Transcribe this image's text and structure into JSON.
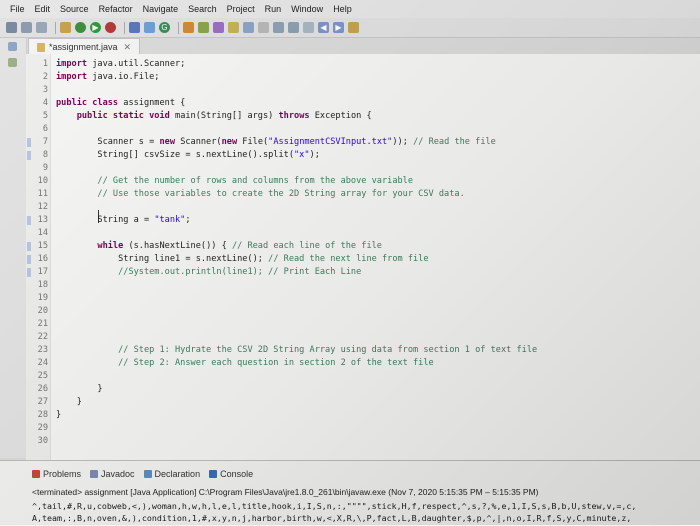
{
  "menu": [
    "File",
    "Edit",
    "Source",
    "Refactor",
    "Navigate",
    "Search",
    "Project",
    "Run",
    "Window",
    "Help"
  ],
  "editor_tab": {
    "label": "*assignment.java",
    "close": "✕"
  },
  "code_lines": [
    {
      "n": "1",
      "html": "<span class=\"kw\">import</span> java.util.Scanner;"
    },
    {
      "n": "2",
      "html": "<span class=\"kw\">import</span> java.io.File;"
    },
    {
      "n": "3",
      "html": ""
    },
    {
      "n": "4",
      "html": "<span class=\"kw\">public class</span> assignment {"
    },
    {
      "n": "5",
      "html": "    <span class=\"kw\">public static void</span> main(String[] args) <span class=\"kw\">throws</span> Exception {"
    },
    {
      "n": "6",
      "html": ""
    },
    {
      "n": "7",
      "html": "        Scanner s = <span class=\"kw\">new</span> Scanner(<span class=\"kw\">new</span> File(<span class=\"str\">\"AssignmentCSVInput.txt\"</span>)); <span class=\"cmt\">// Read the file</span>"
    },
    {
      "n": "8",
      "html": "        String[] csvSize = s.nextLine().split(<span class=\"str\">\"x\"</span>);"
    },
    {
      "n": "9",
      "html": ""
    },
    {
      "n": "10",
      "html": "        <span class=\"cmt\">// Get the number of rows and columns from the above variable</span>"
    },
    {
      "n": "11",
      "html": "        <span class=\"cmt\">// Use those variables to create the 2D String array for your CSV data.</span>"
    },
    {
      "n": "12",
      "html": ""
    },
    {
      "n": "13",
      "html": "        String a = <span class=\"str\">\"tank\"</span>;"
    },
    {
      "n": "14",
      "html": ""
    },
    {
      "n": "15",
      "html": "        <span class=\"kw\">while</span> (s.hasNextLine()) { <span class=\"cmt\">// Read each line of the file</span>"
    },
    {
      "n": "16",
      "html": "            String line1 = s.nextLine(); <span class=\"cmt\">// Read the next line from file</span>"
    },
    {
      "n": "17",
      "html": "            <span class=\"cmt\">//System.out.println(line1); // Print Each Line</span>"
    },
    {
      "n": "18",
      "html": ""
    },
    {
      "n": "19",
      "html": ""
    },
    {
      "n": "20",
      "html": ""
    },
    {
      "n": "21",
      "html": ""
    },
    {
      "n": "22",
      "html": ""
    },
    {
      "n": "23",
      "html": "            <span class=\"cmt\">// Step 1: Hydrate the CSV 2D String Array using data from section 1 of text file</span>"
    },
    {
      "n": "24",
      "html": "            <span class=\"cmt\">// Step 2: Answer each question in section 2 of the text file</span>"
    },
    {
      "n": "25",
      "html": ""
    },
    {
      "n": "26",
      "html": "        }"
    },
    {
      "n": "27",
      "html": "    }"
    },
    {
      "n": "28",
      "html": "}"
    },
    {
      "n": "29",
      "html": ""
    },
    {
      "n": "30",
      "html": ""
    }
  ],
  "console": {
    "tabs": [
      "Problems",
      "Javadoc",
      "Declaration",
      "Console"
    ],
    "status": "<terminated> assignment [Java Application] C:\\Program Files\\Java\\jre1.8.0_261\\bin\\javaw.exe (Nov 7, 2020 5:15:35 PM – 5:15:35 PM)",
    "output": [
      "^,tail,#,R,u,cobweb,<,),woman,h,w,h,l,e,l,title,hook,i,I,S,n,:,\"\"\"\",stick,H,f,respect,^,s,?,%,e,1,I,S,s,B,b,U,stew,v,=,c,",
      "A,team,:,B,n,oven,&,),condition,1,#,x,y,n,j,harbor,birth,w,<,X,R,\\,P,fact,L,B,daughter,$,p,^,|,n,o,I,R,f,S,y,C,minute,z,"
    ]
  },
  "colors": {
    "keyword": "#7f0055",
    "string": "#2a00ff",
    "comment": "#3f7f5f"
  }
}
